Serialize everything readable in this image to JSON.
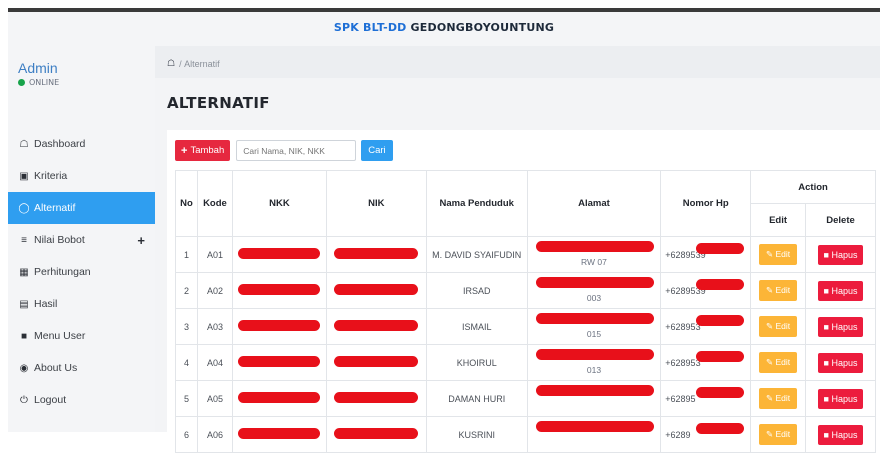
{
  "app": {
    "title_prefix": "SPK BLT-DD ",
    "title_suffix": "GEDONGBOYOUNTUNG"
  },
  "user": {
    "name": "Admin",
    "status": "ONLINE"
  },
  "sidebar": {
    "items": [
      {
        "label": "Dashboard",
        "icon": "home-icon"
      },
      {
        "label": "Kriteria",
        "icon": "cubes-icon"
      },
      {
        "label": "Alternatif",
        "icon": "user-icon",
        "active": true
      },
      {
        "label": "Nilai Bobot",
        "icon": "list-icon"
      },
      {
        "label": "Perhitungan",
        "icon": "calculator-icon"
      },
      {
        "label": "Hasil",
        "icon": "file-icon"
      },
      {
        "label": "Menu User",
        "icon": "user-box-icon"
      },
      {
        "label": "About Us",
        "icon": "info-icon"
      },
      {
        "label": "Logout",
        "icon": "power-icon"
      }
    ]
  },
  "breadcrumb": {
    "current": "Alternatif"
  },
  "page": {
    "heading": "ALTERNATIF"
  },
  "toolbar": {
    "add_label": "Tambah",
    "search_placeholder": "Cari Nama, NIK, NKK",
    "find_label": "Cari"
  },
  "table": {
    "headers": {
      "no": "No",
      "kode": "Kode",
      "nkk": "NKK",
      "nik": "NIK",
      "nama": "Nama Penduduk",
      "alamat": "Alamat",
      "hp": "Nomor Hp",
      "action": "Action",
      "edit": "Edit",
      "delete": "Delete"
    },
    "edit_label": "Edit",
    "delete_label": "Hapus",
    "rows": [
      {
        "no": "1",
        "kode": "A01",
        "nama": "M. DAVID SYAIFUDIN",
        "alamat_sub": "RW 07",
        "hp": "+6289539"
      },
      {
        "no": "2",
        "kode": "A02",
        "nama": "IRSAD",
        "alamat_sub": "003",
        "hp": "+6289539"
      },
      {
        "no": "3",
        "kode": "A03",
        "nama": "ISMAIL",
        "alamat_sub": "015",
        "hp": "+628953"
      },
      {
        "no": "4",
        "kode": "A04",
        "nama": "KHOIRUL",
        "alamat_sub": "013",
        "hp": "+628953"
      },
      {
        "no": "5",
        "kode": "A05",
        "nama": "DAMAN HURI",
        "alamat_sub": "",
        "hp": "+62895"
      },
      {
        "no": "6",
        "kode": "A06",
        "nama": "KUSRINI",
        "alamat_sub": "",
        "hp": "+6289"
      }
    ]
  },
  "colors": {
    "accent": "#2f9ef0",
    "danger": "#e6283f",
    "warning": "#fcb537",
    "redaction": "#e8101a"
  }
}
